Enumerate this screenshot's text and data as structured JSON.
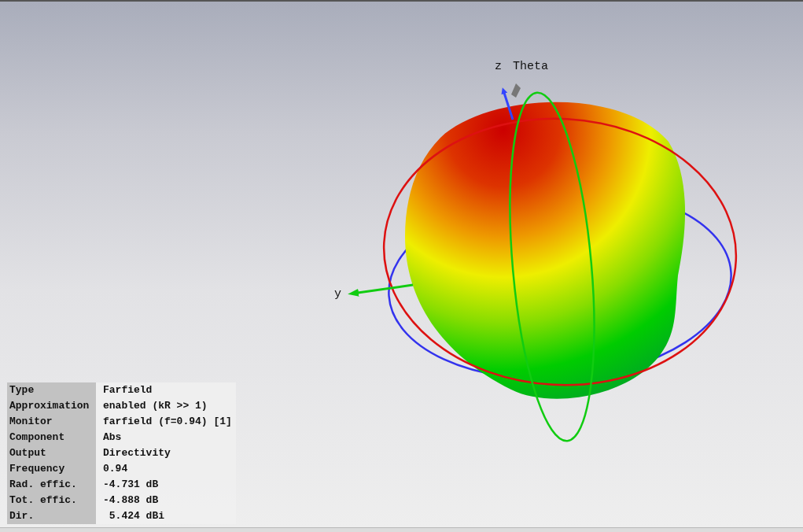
{
  "plot": {
    "axis_labels": {
      "z": "z",
      "theta": "Theta",
      "y": "y"
    }
  },
  "info_table": {
    "rows": [
      {
        "label": "Type",
        "value": "Farfield"
      },
      {
        "label": "Approximation",
        "value": "enabled (kR >> 1)"
      },
      {
        "label": "Monitor",
        "value": "farfield (f=0.94) [1]"
      },
      {
        "label": "Component",
        "value": "Abs"
      },
      {
        "label": "Output",
        "value": "Directivity"
      },
      {
        "label": "Frequency",
        "value": "0.94"
      },
      {
        "label": "Rad. effic.",
        "value": "-4.731 dB"
      },
      {
        "label": "Tot. effic.",
        "value": "-4.888 dB"
      },
      {
        "label": "Dir.",
        "value": " 5.424 dBi"
      }
    ]
  }
}
